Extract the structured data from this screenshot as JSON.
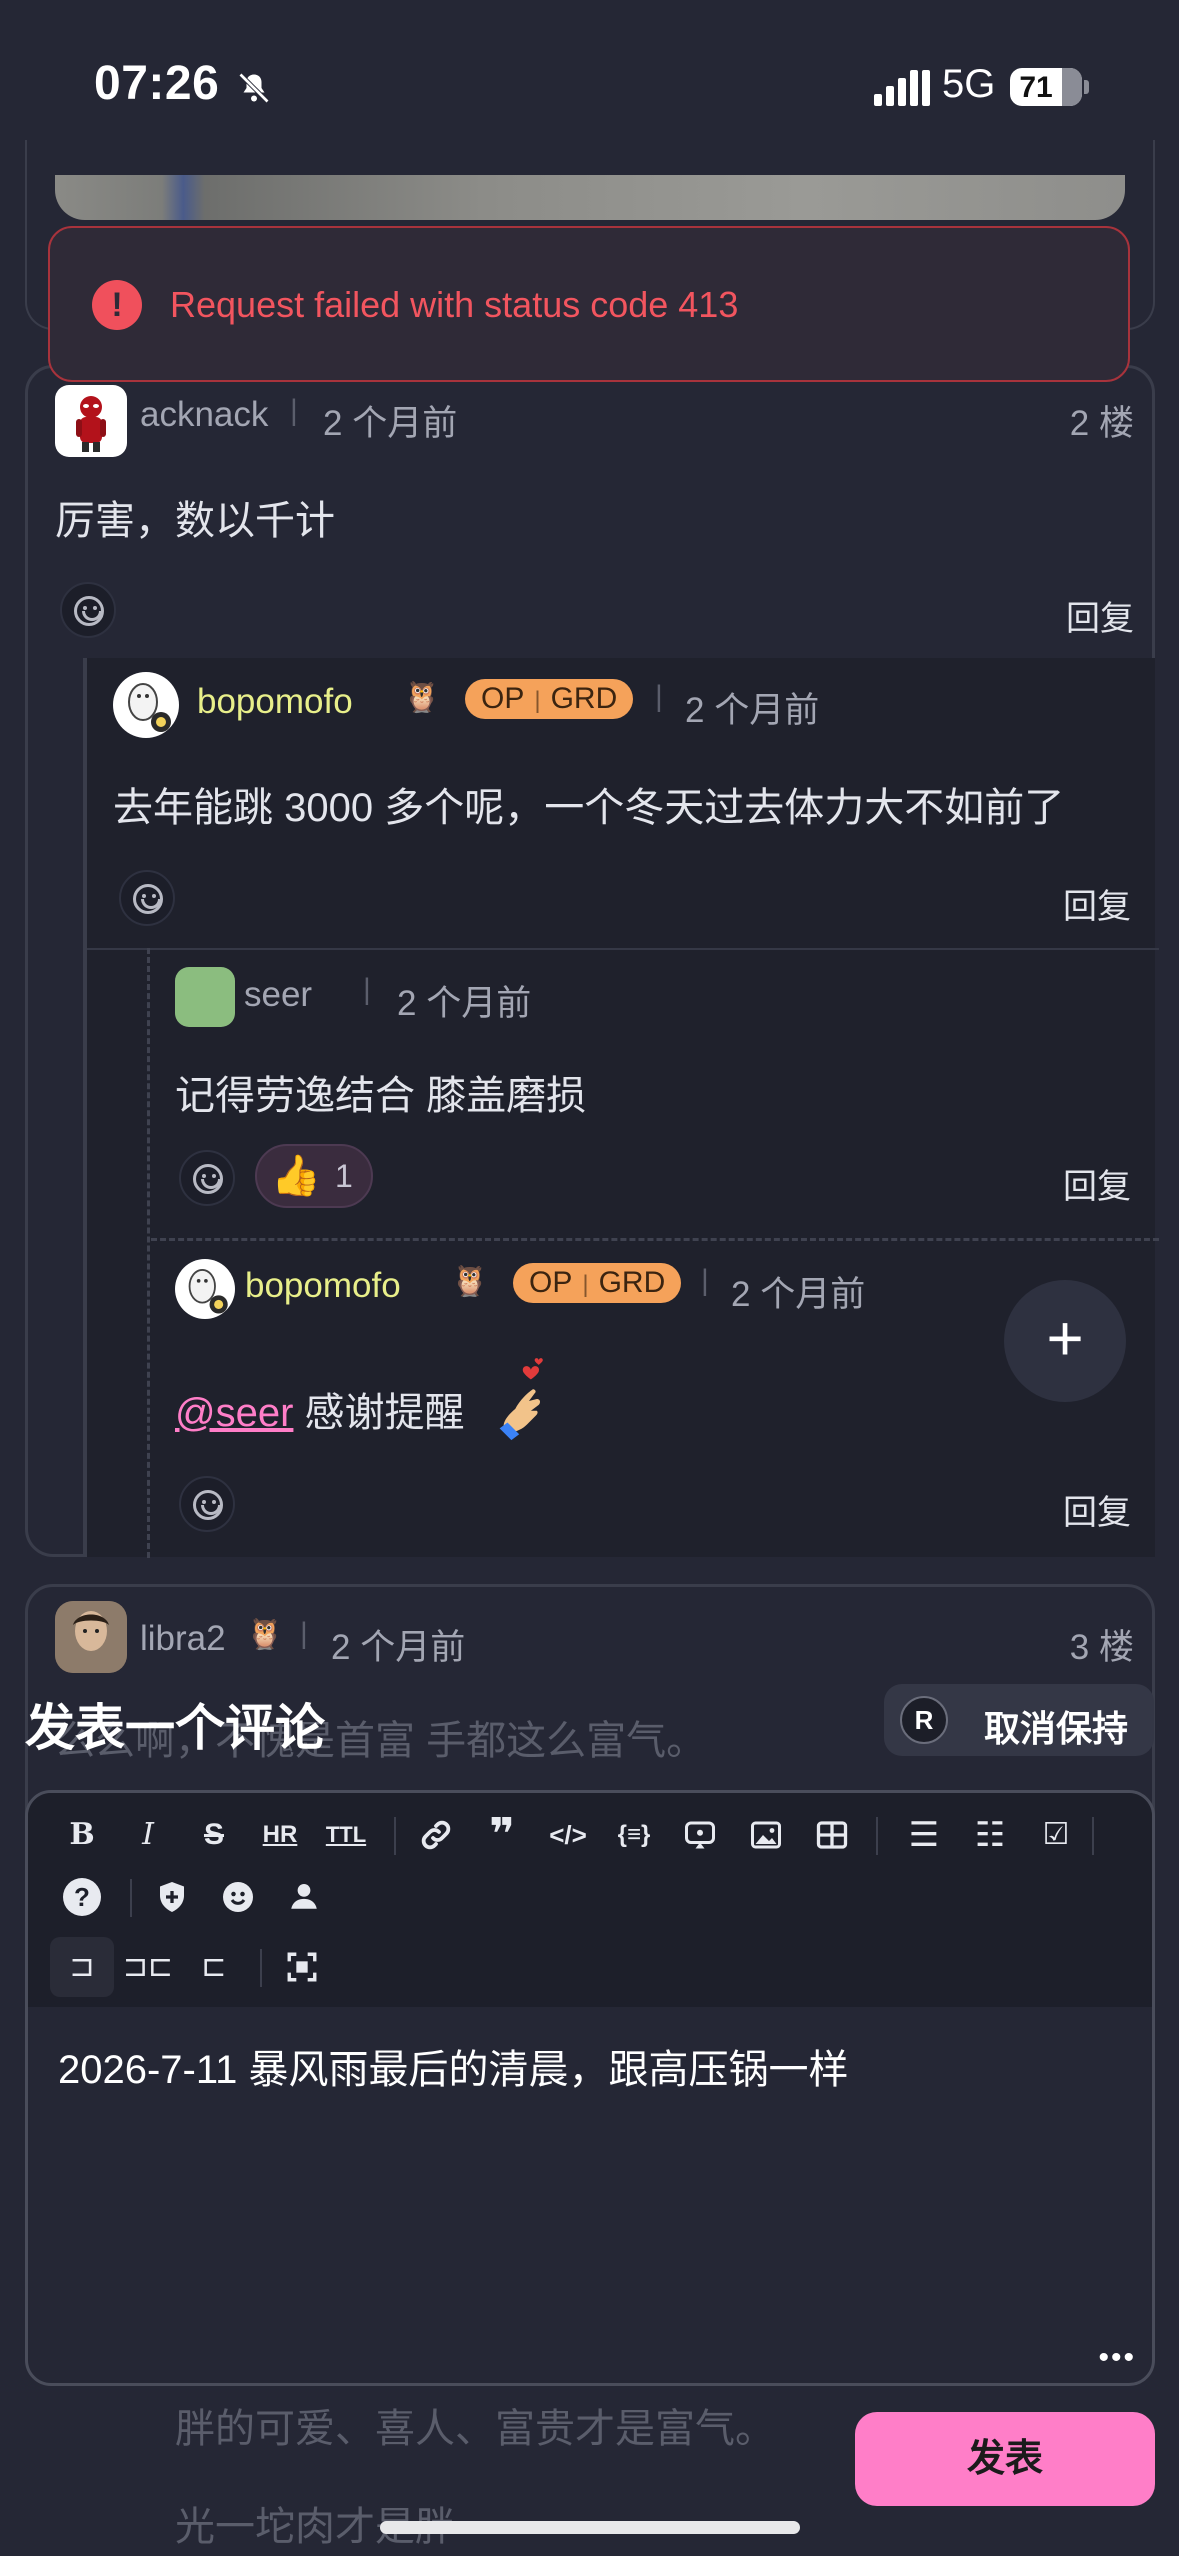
{
  "status_bar": {
    "time": "07:26",
    "network": "5G",
    "battery": "71"
  },
  "toast": {
    "message": "Request failed with status code 413"
  },
  "comment": {
    "author": "acknack",
    "time": "2 个月前",
    "floor": "2 楼",
    "text": "厉害，数以千计",
    "reply_label": "回复"
  },
  "replies": [
    {
      "author": "bopomofo",
      "badge_op": "OP",
      "badge_grd": "GRD",
      "time": "2 个月前",
      "text": "去年能跳 3000 多个呢，一个冬天过去体力大不如前了",
      "reply_label": "回复"
    },
    {
      "author": "seer",
      "time": "2 个月前",
      "text": "记得劳逸结合 膝盖磨损",
      "reaction_count": "1",
      "reply_label": "回复"
    },
    {
      "author": "bopomofo",
      "badge_op": "OP",
      "badge_grd": "GRD",
      "time": "2 个月前",
      "mention": "@seer",
      "text": "感谢提醒",
      "reply_label": "回复"
    }
  ],
  "next_comment": {
    "author": "libra2",
    "time": "2 个月前",
    "floor": "3 楼"
  },
  "compose": {
    "title": "发表一个评论",
    "background_text": "么么啊，不愧是首富 手都这么富气。",
    "release_key": "R",
    "release_label": "取消保持",
    "content": "2026-7-11 暴风雨最后的清晨，跟高压锅一样",
    "publish_label": "发表"
  },
  "background_lines": [
    "胖的可爱、喜人、富贵才是富气。",
    "光一坨肉才是胖"
  ],
  "colors": {
    "accent": "#ff7ec8",
    "error": "#f2555f",
    "username_op": "#e8ef8a",
    "badge": "#f5a25a",
    "mention": "#ff7ec8"
  }
}
